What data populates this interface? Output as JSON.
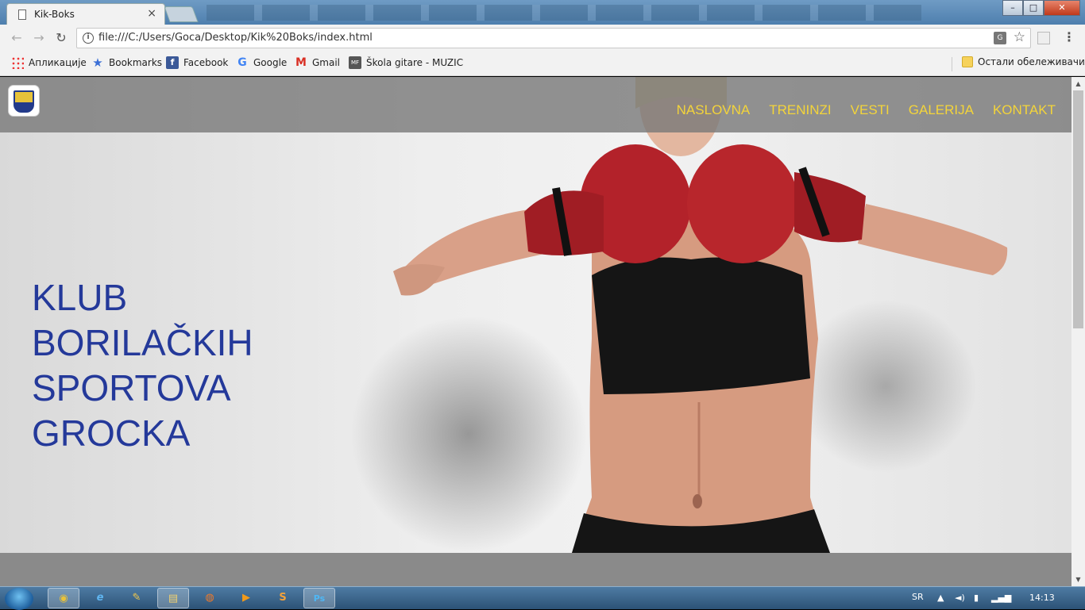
{
  "browser": {
    "tab_title": "Kik-Boks",
    "tab_close": "×",
    "url": "file:///C:/Users/Goca/Desktop/Kik%20Boks/index.html",
    "back": "←",
    "forward": "→",
    "reload": "↻",
    "menu": "⋮",
    "star": "☆",
    "translate": "G",
    "win_min": "–",
    "win_max": "□",
    "win_close": "✕"
  },
  "bookmarks": [
    {
      "label": "Апликације",
      "icon": "apps-icon"
    },
    {
      "label": "Bookmarks",
      "icon": "star-icon"
    },
    {
      "label": "Facebook",
      "icon": "facebook-icon",
      "glyph": "f"
    },
    {
      "label": "Google",
      "icon": "google-icon",
      "glyph": "G"
    },
    {
      "label": "Gmail",
      "icon": "gmail-icon",
      "glyph": "M"
    },
    {
      "label": "Škola gitare - MUZIC",
      "icon": "mf-icon",
      "glyph": "MF"
    }
  ],
  "other_bookmarks": "Остали обележивачи",
  "site": {
    "nav": [
      "NASLOVNA",
      "TRENINZI",
      "VESTI",
      "GALERIJA",
      "KONTAKT"
    ],
    "headline": [
      "KLUB",
      "BORILAČKIH",
      "SPORTOVA",
      "GROCKA"
    ],
    "accent_color": "#f3d43a",
    "headline_color": "#24399a"
  },
  "taskbar": {
    "language": "SR",
    "time": "14:13",
    "apps": [
      {
        "name": "chrome-icon",
        "glyph": "◉"
      },
      {
        "name": "ie-icon",
        "glyph": "e"
      },
      {
        "name": "app-icon",
        "glyph": "✎"
      },
      {
        "name": "explorer-icon",
        "glyph": "▤"
      },
      {
        "name": "firefox-icon",
        "glyph": "◍"
      },
      {
        "name": "media-player-icon",
        "glyph": "▶"
      },
      {
        "name": "sublime-icon",
        "glyph": "S"
      },
      {
        "name": "photoshop-icon",
        "glyph": "Ps"
      }
    ]
  }
}
